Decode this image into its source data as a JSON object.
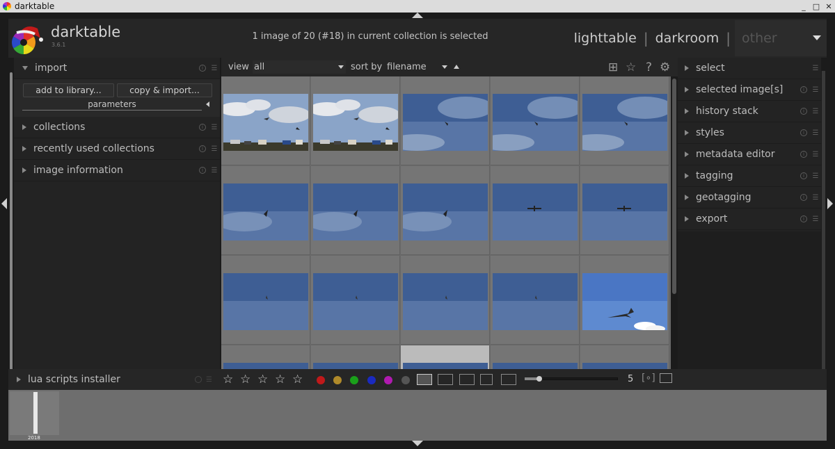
{
  "window": {
    "title": "darktable",
    "controls": [
      "_",
      "□",
      "✕"
    ]
  },
  "header": {
    "brand": "darktable",
    "version": "3.6.1",
    "status": "1 image of 20 (#18) in current collection is selected",
    "views": [
      "lighttable",
      "darkroom",
      "other"
    ],
    "separator": "|"
  },
  "left_panel": {
    "import": {
      "label": "import",
      "add_button": "add to library...",
      "copy_button": "copy & import...",
      "parameters": "parameters"
    },
    "modules": [
      "collections",
      "recently used collections",
      "image information"
    ],
    "bottom_module": "lua scripts installer"
  },
  "top_toolbar": {
    "view_label": "view",
    "view_value": "all",
    "sort_label": "sort by",
    "sort_value": "filename",
    "icons": [
      "grouping-icon",
      "star-icon",
      "help-icon",
      "gear-icon"
    ]
  },
  "right_panel": {
    "modules": [
      "select",
      "selected image[s]",
      "history stack",
      "styles",
      "metadata editor",
      "tagging",
      "geotagging",
      "export"
    ]
  },
  "lighttable": {
    "columns": 5,
    "rows_visible": 4,
    "selected_index": 17,
    "thumbnails": [
      {
        "scene": "plane-field"
      },
      {
        "scene": "plane-field"
      },
      {
        "scene": "sky-cloud-bird"
      },
      {
        "scene": "sky-cloud-bird"
      },
      {
        "scene": "sky-cloud-bird"
      },
      {
        "scene": "sky-bird"
      },
      {
        "scene": "sky-bird"
      },
      {
        "scene": "sky-bird"
      },
      {
        "scene": "sky-plane"
      },
      {
        "scene": "sky-plane"
      },
      {
        "scene": "sky-bird-small"
      },
      {
        "scene": "sky-bird-small"
      },
      {
        "scene": "sky-bird-small"
      },
      {
        "scene": "sky-bird-small"
      },
      {
        "scene": "sky-plane-big"
      },
      {
        "scene": "sky"
      },
      {
        "scene": "sky"
      },
      {
        "scene": "sky"
      },
      {
        "scene": "sky"
      },
      {
        "scene": "sky"
      }
    ]
  },
  "bottom_toolbar": {
    "stars": [
      "☆",
      "☆",
      "☆",
      "☆",
      "☆"
    ],
    "color_labels": [
      "#c0191a",
      "#b08a2a",
      "#1aa01a",
      "#1a2ac0",
      "#b01ab0",
      "#555555"
    ],
    "zoom_fraction": 0.15,
    "zoom": "5"
  },
  "filmstrip": {
    "timeline_label": "2018"
  }
}
